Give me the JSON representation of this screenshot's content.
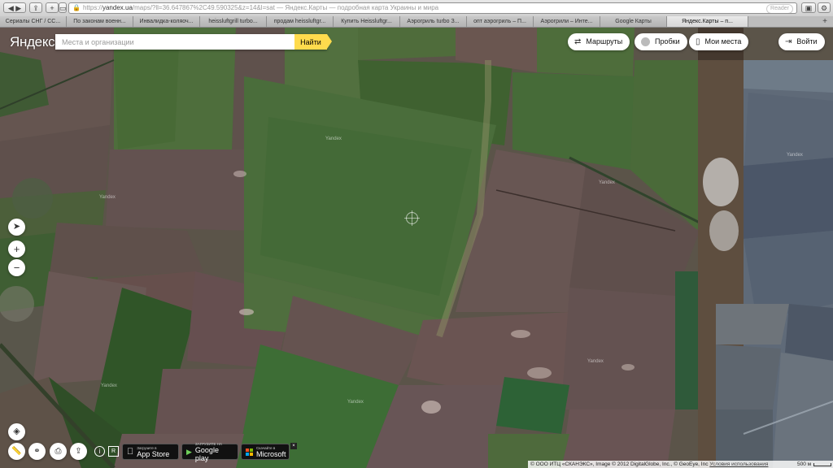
{
  "browser": {
    "url_scheme": "https://",
    "url_host": "yandex.ua",
    "url_rest": "/maps/?ll=36.647867%2C49.590325&z=14&l=sat",
    "page_title": " — Яндекс.Карты — подробная карта Украины и мира",
    "reader_label": "Reader",
    "tabs": [
      {
        "label": "Сериалы СНГ / СС..."
      },
      {
        "label": "По законам военн..."
      },
      {
        "label": "Инвалидка-коляоч..."
      },
      {
        "label": "heissluftgrill turbo..."
      },
      {
        "label": "продам heissluftgr..."
      },
      {
        "label": "Купить Heissluftgr..."
      },
      {
        "label": "Аэрогриль turbo З..."
      },
      {
        "label": "опт аэрогриль – П..."
      },
      {
        "label": "Аэрогрили – Инте..."
      },
      {
        "label": "Google Карты"
      },
      {
        "label": "Яндекс.Карты – п...",
        "active": true
      }
    ]
  },
  "header": {
    "logo_text": "Яндекс",
    "search_placeholder": "Места и организации",
    "search_button_label": "Найти",
    "routes_label": "Маршруты",
    "traffic_label": "Пробки",
    "my_places_label": "Мои места",
    "login_label": "Войти"
  },
  "watermark_text": "Yandex",
  "stores": {
    "appstore_small": "Загрузите в",
    "appstore_big": "App Store",
    "googleplay_small": "ЗАГРУЗИТЕ НА",
    "googleplay_big": "Google play",
    "microsoft_small": "Скачайте в",
    "microsoft_big": "Microsoft",
    "close_label": "×"
  },
  "footer": {
    "copyright": "© ООО ИТЦ «СКАНЭКС», Image © 2012 DigitalGlobe, Inc., © GeoEye, Inc",
    "terms_label": "Условия использования",
    "scale_label": "500 м"
  },
  "icons": {
    "locate": "navigation-arrow-icon",
    "zoom_in": "plus-icon",
    "zoom_out": "minus-icon",
    "layers": "layers-icon",
    "ruler": "ruler-icon",
    "panorama": "binoculars-icon",
    "print": "printer-icon",
    "share": "share-icon",
    "info": "info-icon",
    "feedback": "feedback-icon"
  }
}
